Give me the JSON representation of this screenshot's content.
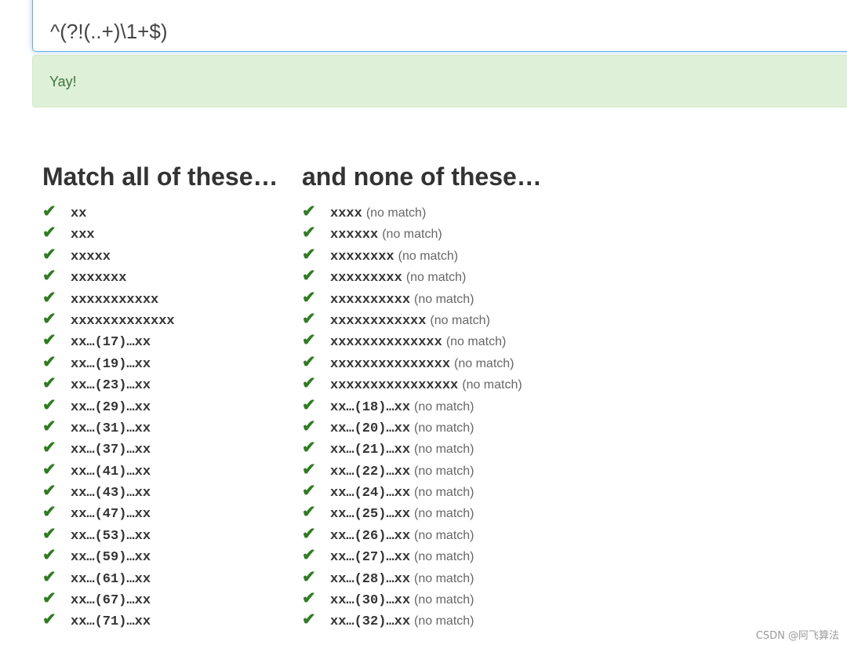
{
  "regex": {
    "value": "^(?!(..+)\\1+$)"
  },
  "alert": {
    "text": "Yay!"
  },
  "match_column": {
    "heading": "Match all of these…",
    "items": [
      "xx",
      "xxx",
      "xxxxx",
      "xxxxxxx",
      "xxxxxxxxxxx",
      "xxxxxxxxxxxxx",
      "xx…(17)…xx",
      "xx…(19)…xx",
      "xx…(23)…xx",
      "xx…(29)…xx",
      "xx…(31)…xx",
      "xx…(37)…xx",
      "xx…(41)…xx",
      "xx…(43)…xx",
      "xx…(47)…xx",
      "xx…(53)…xx",
      "xx…(59)…xx",
      "xx…(61)…xx",
      "xx…(67)…xx",
      "xx…(71)…xx"
    ]
  },
  "nomatch_column": {
    "heading": "and none of these…",
    "note": "(no match)",
    "items": [
      "xxxx",
      "xxxxxx",
      "xxxxxxxx",
      "xxxxxxxxx",
      "xxxxxxxxxx",
      "xxxxxxxxxxxx",
      "xxxxxxxxxxxxxx",
      "xxxxxxxxxxxxxxx",
      "xxxxxxxxxxxxxxxx",
      "xx…(18)…xx",
      "xx…(20)…xx",
      "xx…(21)…xx",
      "xx…(22)…xx",
      "xx…(24)…xx",
      "xx…(25)…xx",
      "xx…(26)…xx",
      "xx…(27)…xx",
      "xx…(28)…xx",
      "xx…(30)…xx",
      "xx…(32)…xx"
    ]
  },
  "check_glyph": "✔",
  "colors": {
    "check": "#2e7d20",
    "alert_bg": "#dff0d8",
    "alert_text": "#3c763d",
    "focus_border": "#66afe9"
  },
  "icons": {
    "check": "check-icon"
  },
  "watermark": "CSDN @阿飞算法"
}
